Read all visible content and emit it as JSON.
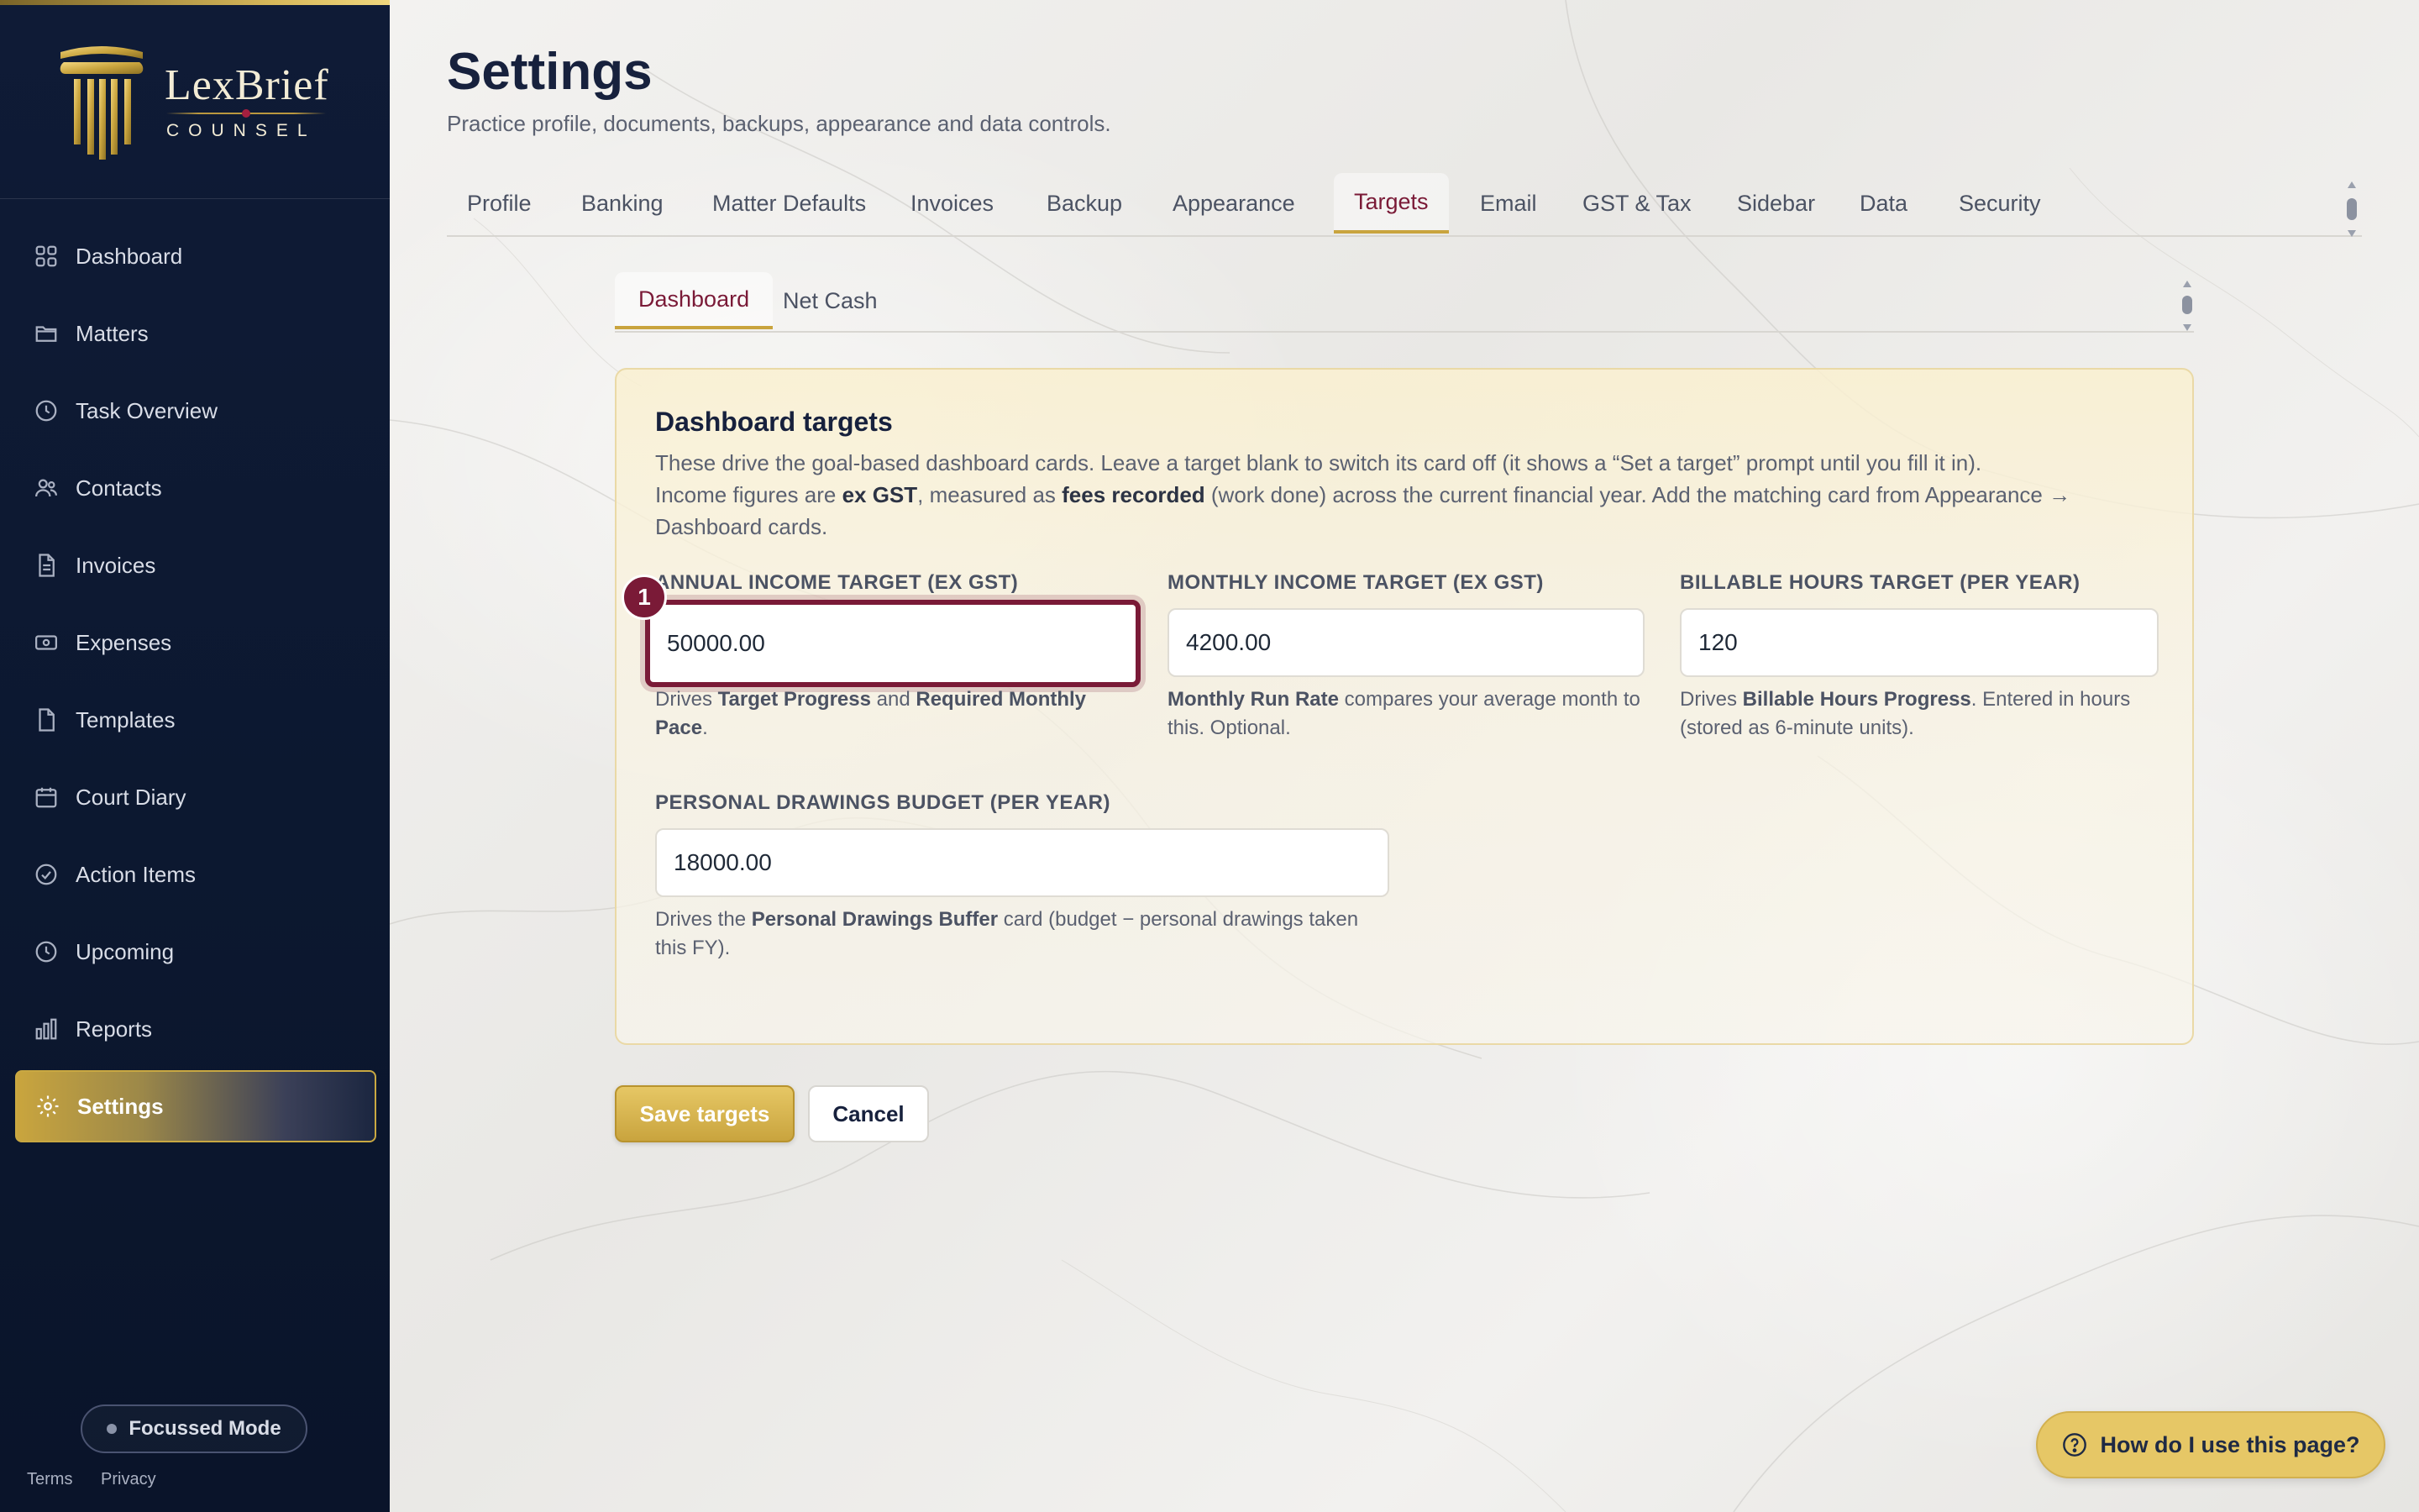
{
  "brand": {
    "name": "LexBrief",
    "sub": "COUNSEL"
  },
  "sidebar": {
    "items": [
      {
        "label": "Dashboard",
        "icon": "grid-icon"
      },
      {
        "label": "Matters",
        "icon": "folder-icon"
      },
      {
        "label": "Task Overview",
        "icon": "clock-icon"
      },
      {
        "label": "Contacts",
        "icon": "users-icon"
      },
      {
        "label": "Invoices",
        "icon": "file-text-icon"
      },
      {
        "label": "Expenses",
        "icon": "banknote-icon"
      },
      {
        "label": "Templates",
        "icon": "file-icon"
      },
      {
        "label": "Court Diary",
        "icon": "calendar-icon"
      },
      {
        "label": "Action Items",
        "icon": "check-circle-icon"
      },
      {
        "label": "Upcoming",
        "icon": "clock-icon"
      },
      {
        "label": "Reports",
        "icon": "bar-chart-icon"
      },
      {
        "label": "Settings",
        "icon": "gear-icon",
        "active": true
      }
    ],
    "focus_mode": "Focussed Mode",
    "footer": {
      "terms": "Terms",
      "privacy": "Privacy"
    }
  },
  "header": {
    "title": "Settings",
    "subtitle": "Practice profile, documents, backups, appearance and data controls."
  },
  "tabs": [
    "Profile",
    "Banking",
    "Matter Defaults",
    "Invoices",
    "Backup",
    "Appearance",
    "Targets",
    "Email",
    "GST & Tax",
    "Sidebar",
    "Data",
    "Security"
  ],
  "active_tab": "Targets",
  "subtabs": [
    "Dashboard",
    "Net Cash"
  ],
  "active_subtab": "Dashboard",
  "card": {
    "title": "Dashboard targets",
    "desc_1": "These drive the goal-based dashboard cards. Leave a target blank to switch its card off (it shows a “Set a target” prompt until you fill it in).",
    "desc_2a": "Income figures are ",
    "desc_2b": "ex GST",
    "desc_2c": ", measured as ",
    "desc_2d": "fees recorded",
    "desc_2e": " (work done) across the current financial year. Add the matching card from Appearance →",
    "desc_3": "Dashboard cards.",
    "fields": {
      "annual": {
        "label": "ANNUAL INCOME TARGET (EX GST)",
        "value": "50000.00",
        "help_a": "Drives ",
        "help_b": "Target Progress",
        "help_c": " and ",
        "help_d": "Required Monthly Pace",
        "help_e": "."
      },
      "monthly": {
        "label": "MONTHLY INCOME TARGET (EX GST)",
        "value": "4200.00",
        "help_b": "Monthly Run Rate",
        "help_c": " compares your average month to this. Optional."
      },
      "hours": {
        "label": "BILLABLE HOURS TARGET (PER YEAR)",
        "value": "120",
        "help_a": "Drives ",
        "help_b": "Billable Hours Progress",
        "help_c": ". Entered in hours (stored as 6-minute units)."
      },
      "drawings": {
        "label": "PERSONAL DRAWINGS BUDGET (PER YEAR)",
        "value": "18000.00",
        "help_a": "Drives the ",
        "help_b": "Personal Drawings Buffer",
        "help_c": " card (budget − personal drawings taken this FY)."
      }
    },
    "badge": "1"
  },
  "actions": {
    "save": "Save targets",
    "cancel": "Cancel"
  },
  "help": {
    "label": "How do I use this page?"
  },
  "colors": {
    "accent_gold": "#c9a43e",
    "accent_burgundy": "#7a1a37",
    "sidebar_navy": "#0f1b36"
  }
}
